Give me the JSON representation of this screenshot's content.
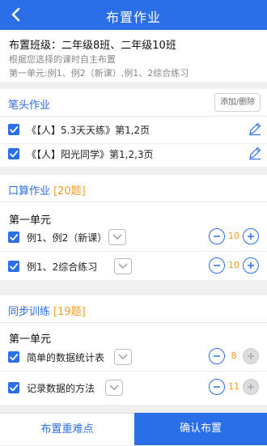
{
  "header": {
    "title": "布置作业",
    "back_icon": "chevron-left-icon"
  },
  "info": {
    "class_line": "布置班级：二年级8班、二年级10班",
    "hint": "根据您选择的课时自主布置",
    "unit_summary": "第一单元:例1、例2（新课）,例1、2综合练习"
  },
  "pen": {
    "title": "笔头作业",
    "add_label": "添加/删除",
    "items": [
      {
        "label": "《【人】5.3天天练》第1,2页",
        "checked": true
      },
      {
        "label": "《【人】阳光同学》第1,2,3页",
        "checked": true
      }
    ]
  },
  "oral": {
    "title": "口算作业",
    "count": "[20题]",
    "unit": "第一单元",
    "items": [
      {
        "label": "例1、例2（新课）",
        "value": "10",
        "checked": true
      },
      {
        "label": "例1、2综合练习",
        "value": "10",
        "checked": true
      }
    ]
  },
  "sync": {
    "title": "同步训练",
    "count": "[19题]",
    "unit": "第一单元",
    "items": [
      {
        "label": "简单的数据统计表",
        "value": "8",
        "checked": true
      },
      {
        "label": "记录数据的方法",
        "value": "11",
        "checked": true
      }
    ]
  },
  "footer": {
    "left_label": "布置重难点",
    "right_label": "确认布置"
  },
  "colors": {
    "primary": "#2a6ee8",
    "accent": "#f59b23"
  }
}
